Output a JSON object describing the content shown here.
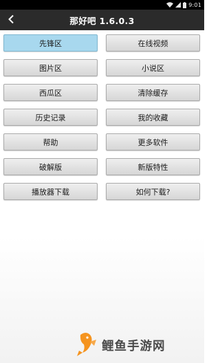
{
  "status_bar": {
    "time": "9:01",
    "icons": [
      "wifi-icon",
      "signal-icon",
      "battery-icon"
    ]
  },
  "header": {
    "title": "那好吧 1.6.0.3",
    "back_icon": "chevron-left-icon"
  },
  "menu": {
    "buttons": [
      {
        "label": "先锋区",
        "selected": true
      },
      {
        "label": "在线视频"
      },
      {
        "label": "图片区"
      },
      {
        "label": "小说区"
      },
      {
        "label": "西瓜区"
      },
      {
        "label": "清除缓存"
      },
      {
        "label": "历史记录"
      },
      {
        "label": "我的收藏"
      },
      {
        "label": "帮助"
      },
      {
        "label": "更多软件"
      },
      {
        "label": "破解版"
      },
      {
        "label": "新版特性"
      },
      {
        "label": "播放器下载"
      },
      {
        "label": "如何下载?"
      }
    ]
  },
  "watermark": {
    "text": "鲤鱼手游网",
    "logo_icon": "goldfish-logo-icon"
  },
  "colors": {
    "status_bar": "#000000",
    "title_bar": "#2b2b2b",
    "selected_button": "#a8d8ee",
    "button": "#e3e3e3",
    "logo_orange": "#f5941f"
  }
}
